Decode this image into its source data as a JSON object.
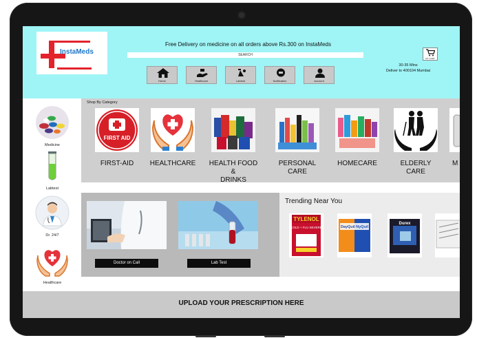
{
  "app": {
    "logo_text": "InstaMeds"
  },
  "header": {
    "promo_text": "Free Delivery on  medicine on all orders above Rs.300 on InstaMeds",
    "search_label": "SEARCH",
    "nav": [
      {
        "label": "Home",
        "icon": "home-icon"
      },
      {
        "label": "Healthcare",
        "icon": "healthcare-icon"
      },
      {
        "label": "Labtest",
        "icon": "labtest-icon"
      },
      {
        "label": "Notification",
        "icon": "notification-icon"
      },
      {
        "label": "Account",
        "icon": "account-icon"
      }
    ],
    "cart_label": "MY CART",
    "eta_line1": "30-35 Mins",
    "eta_line2": "Deliver to 400104 Mumbai"
  },
  "sidebar": {
    "items": [
      {
        "label": "Medicine",
        "icon": "pills-icon"
      },
      {
        "label": "Labtest",
        "icon": "test-tube-icon"
      },
      {
        "label": "Dr. 24/7",
        "icon": "doctor-icon"
      },
      {
        "label": "Healthcare",
        "icon": "heart-hands-icon"
      }
    ]
  },
  "categories": {
    "title": "Shop By Category",
    "items": [
      {
        "line1": "FIRST-AID",
        "line2": "",
        "image_text": "FIRST AID"
      },
      {
        "line1": "HEALTHCARE",
        "line2": ""
      },
      {
        "line1": "HEALTH FOOD &",
        "line2": "DRINKS"
      },
      {
        "line1": "PERSONAL",
        "line2": "CARE"
      },
      {
        "line1": "HOMECARE",
        "line2": ""
      },
      {
        "line1": "ELDERLY CARE",
        "line2": ""
      },
      {
        "line1": "M",
        "line2": ""
      }
    ]
  },
  "services": [
    {
      "label": "Doctor on Call"
    },
    {
      "label": "Lab Test"
    }
  ],
  "trending": {
    "title": "Trending Near You",
    "products": [
      {
        "name": "TYLENOL",
        "sub": "COLD + FLU SEVERE"
      },
      {
        "name": "DayQuil NyQuil",
        "sub": ""
      },
      {
        "name": "Durex",
        "sub": ""
      },
      {
        "name": "",
        "sub": ""
      }
    ]
  },
  "upload": {
    "label": "UPLOAD YOUR PRESCRIPTION HERE"
  },
  "colors": {
    "header_bg": "#9ff4f5",
    "accent_red": "#e3222b",
    "logo_blue": "#1f77c8"
  }
}
